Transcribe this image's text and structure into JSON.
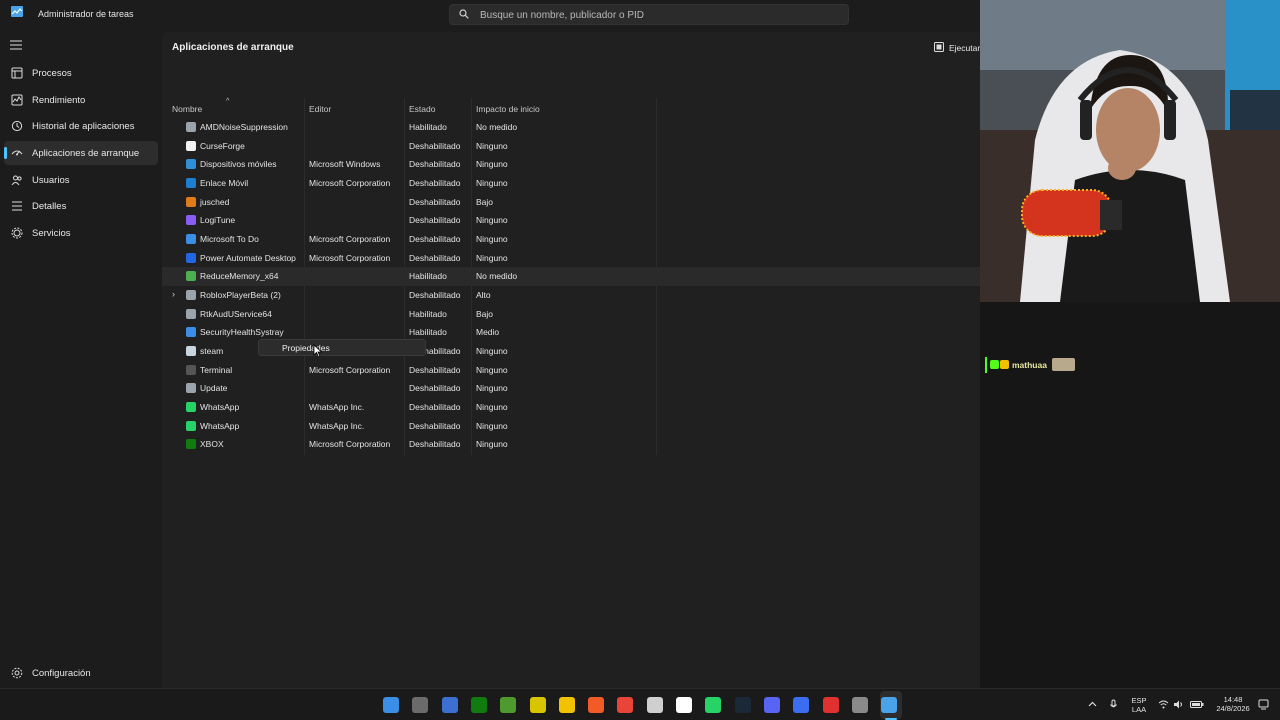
{
  "window": {
    "title": "Administrador de tareas"
  },
  "search": {
    "placeholder": "Busque un nombre, publicador o PID"
  },
  "sidebar": {
    "items": [
      {
        "label": "Procesos",
        "icon": "processes-icon"
      },
      {
        "label": "Rendimiento",
        "icon": "performance-icon"
      },
      {
        "label": "Historial de aplicaciones",
        "icon": "history-icon"
      },
      {
        "label": "Aplicaciones de arranque",
        "icon": "startup-icon",
        "active": true
      },
      {
        "label": "Usuarios",
        "icon": "users-icon"
      },
      {
        "label": "Detalles",
        "icon": "details-icon"
      },
      {
        "label": "Servicios",
        "icon": "services-icon"
      }
    ],
    "settings_label": "Configuración"
  },
  "main": {
    "title": "Aplicaciones de arranque",
    "run_label": "Ejecutar",
    "columns": [
      "Nombre",
      "Editor",
      "Estado",
      "Impacto de inicio"
    ],
    "rows": [
      {
        "name": "AMDNoiseSuppression",
        "editor": "",
        "status": "Habilitado",
        "impact": "No medido",
        "color": "#9aa4ad"
      },
      {
        "name": "CurseForge",
        "editor": "",
        "status": "Deshabilitado",
        "impact": "Ninguno",
        "color": "#f2f2f2"
      },
      {
        "name": "Dispositivos móviles",
        "editor": "Microsoft Windows",
        "status": "Deshabilitado",
        "impact": "Ninguno",
        "color": "#2f8fd8"
      },
      {
        "name": "Enlace Móvil",
        "editor": "Microsoft Corporation",
        "status": "Deshabilitado",
        "impact": "Ninguno",
        "color": "#1e7fd0"
      },
      {
        "name": "jusched",
        "editor": "",
        "status": "Deshabilitado",
        "impact": "Bajo",
        "color": "#e07b1a"
      },
      {
        "name": "LogiTune",
        "editor": "",
        "status": "Deshabilitado",
        "impact": "Ninguno",
        "color": "#8a5cf6"
      },
      {
        "name": "Microsoft To Do",
        "editor": "Microsoft Corporation",
        "status": "Deshabilitado",
        "impact": "Ninguno",
        "color": "#3a8ee6"
      },
      {
        "name": "Power Automate Desktop",
        "editor": "Microsoft Corporation",
        "status": "Deshabilitado",
        "impact": "Ninguno",
        "color": "#2266e3"
      },
      {
        "name": "ReduceMemory_x64",
        "editor": "",
        "status": "Habilitado",
        "impact": "No medido",
        "color": "#4caf50"
      },
      {
        "name": "RobloxPlayerBeta (2)",
        "editor": "",
        "status": "Deshabilitado",
        "impact": "Alto",
        "color": "#9aa4ad",
        "expandable": true
      },
      {
        "name": "RtkAudUService64",
        "editor": "",
        "status": "Habilitado",
        "impact": "Bajo",
        "color": "#9aa4ad"
      },
      {
        "name": "SecurityHealthSystray",
        "editor": "",
        "status": "Habilitado",
        "impact": "Medio",
        "color": "#3a8ee6"
      },
      {
        "name": "steam",
        "editor": "",
        "status": "Deshabilitado",
        "impact": "Ninguno",
        "color": "#c7d5e0"
      },
      {
        "name": "Terminal",
        "editor": "Microsoft Corporation",
        "status": "Deshabilitado",
        "impact": "Ninguno",
        "color": "#555555"
      },
      {
        "name": "Update",
        "editor": "",
        "status": "Deshabilitado",
        "impact": "Ninguno",
        "color": "#9aa4ad"
      },
      {
        "name": "WhatsApp",
        "editor": "WhatsApp Inc.",
        "status": "Deshabilitado",
        "impact": "Ninguno",
        "color": "#25d366"
      },
      {
        "name": "WhatsApp",
        "editor": "WhatsApp Inc.",
        "status": "Deshabilitado",
        "impact": "Ninguno",
        "color": "#25d366"
      },
      {
        "name": "XBOX",
        "editor": "Microsoft Corporation",
        "status": "Deshabilitado",
        "impact": "Ninguno",
        "color": "#107c10"
      }
    ],
    "highlighted_row": 8
  },
  "context_menu": {
    "item": "Propiedades"
  },
  "chat": {
    "username": "mathuaa"
  },
  "taskbar": {
    "apps": [
      "windows-start-icon",
      "widgets-icon",
      "store-icon",
      "xbox-icon",
      "minecraft-icon",
      "game-icon",
      "file-explorer-icon",
      "brave-icon",
      "chrome-icon",
      "openai-icon",
      "capcut-icon",
      "whatsapp-icon",
      "steam-icon",
      "discord-icon",
      "roblox-icon",
      "obs-icon",
      "settings-icon",
      "task-manager-icon"
    ],
    "lang_top": "ESP",
    "lang_bottom": "LAA",
    "time": "14:48",
    "date": "24/8/2026"
  },
  "colors": {
    "accent": "#4cc2ff",
    "background": "#202020",
    "sidebar": "#1c1c1c"
  }
}
